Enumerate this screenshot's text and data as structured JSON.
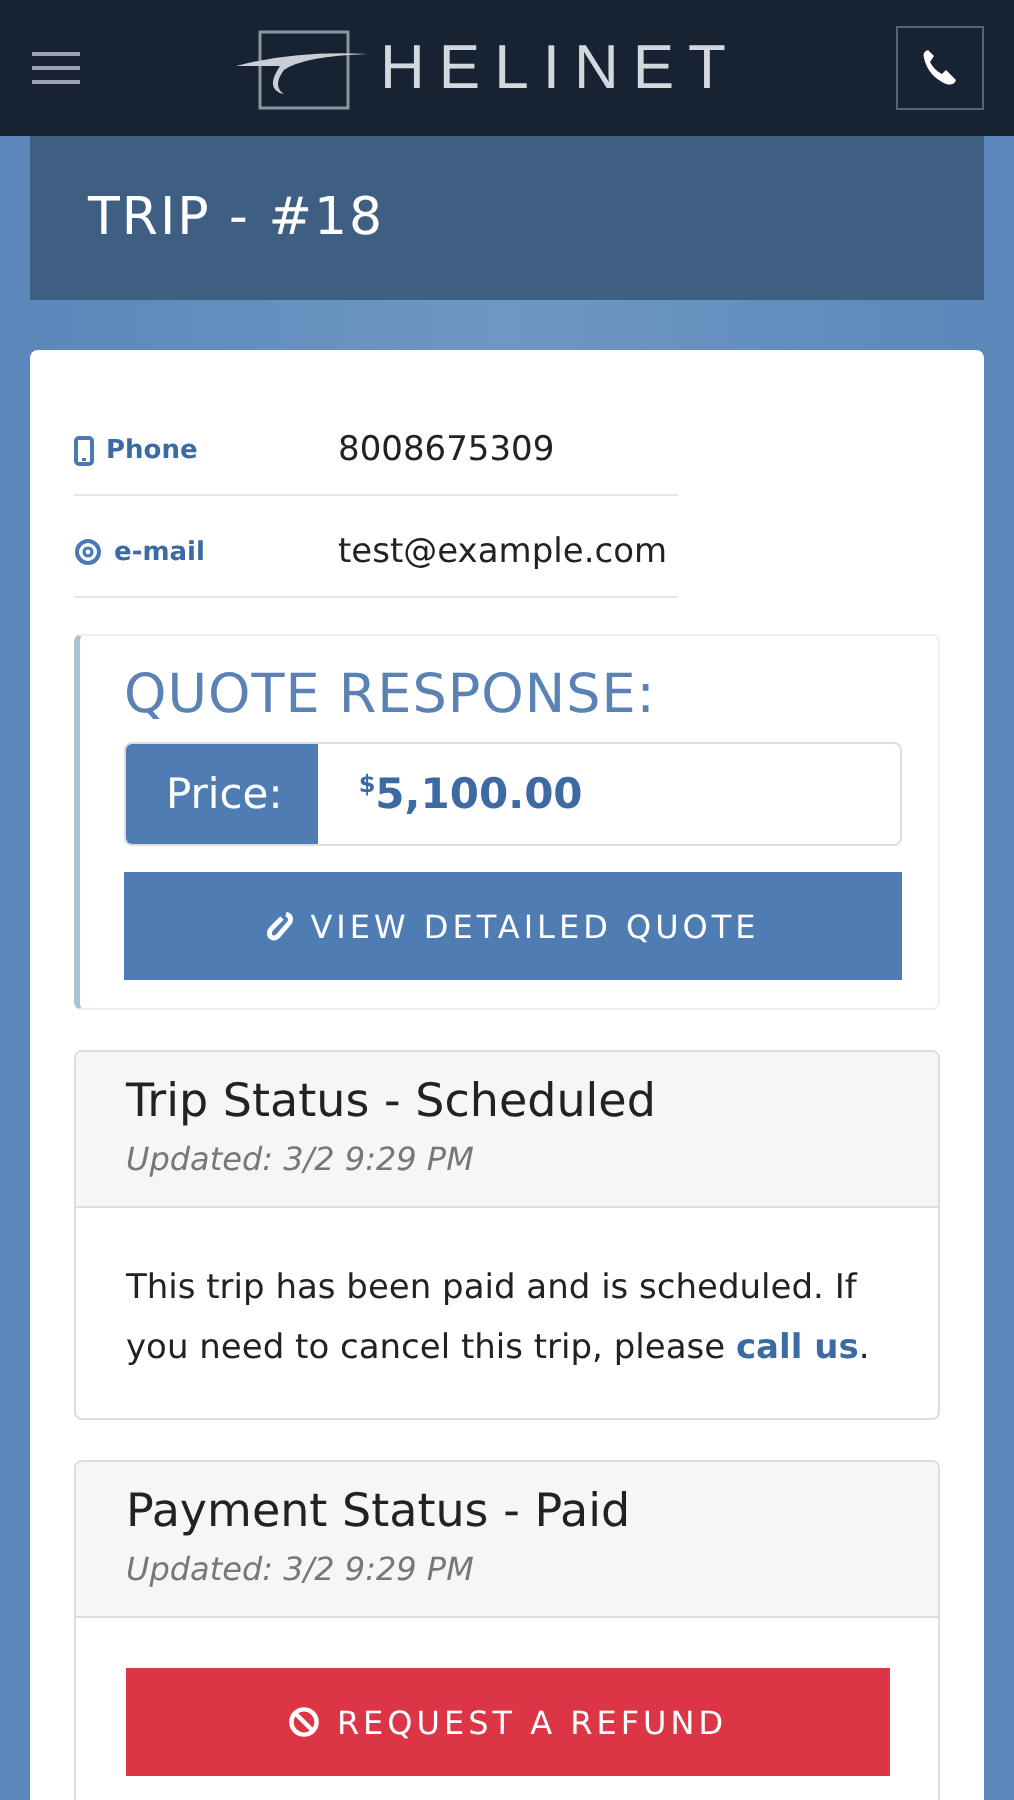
{
  "header": {
    "logo_text": "HELINET"
  },
  "page_title": "TRIP - #18",
  "contacts": [
    {
      "kind": "phone",
      "label": "Phone",
      "value": "8008675309"
    },
    {
      "kind": "email",
      "label": "e-mail",
      "value": "test@example.com"
    }
  ],
  "quote": {
    "heading": "QUOTE RESPONSE:",
    "price_label": "Price:",
    "currency": "$",
    "amount": "5,100.00",
    "button": "VIEW DETAILED QUOTE"
  },
  "panels": [
    {
      "title": "Trip Status - Scheduled",
      "updated": "Updated: 3/2 9:29 PM",
      "body": {
        "text": "This trip has been paid and is scheduled. If you need to cancel this trip, please ",
        "link": "call us",
        "after": "."
      }
    },
    {
      "title": "Payment Status - Paid",
      "updated": "Updated: 3/2 9:29 PM",
      "button": "REQUEST A REFUND"
    }
  ]
}
